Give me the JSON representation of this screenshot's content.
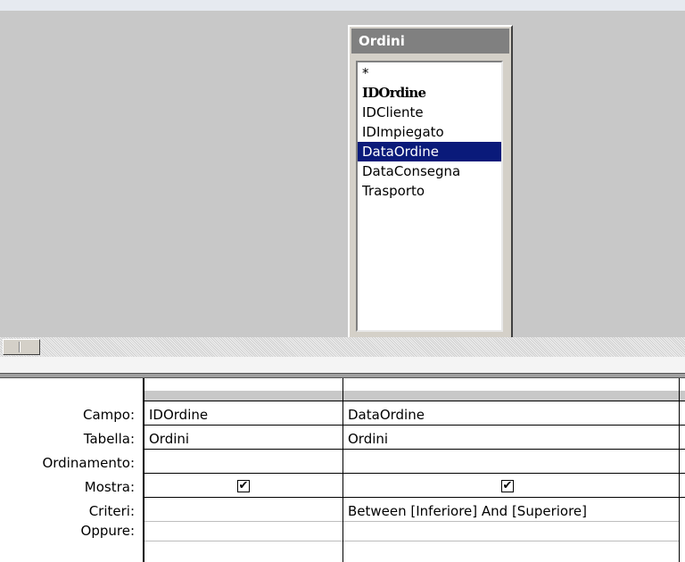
{
  "table": {
    "name": "Ordini",
    "fields": [
      "*",
      "IDOrdine",
      "IDCliente",
      "IDImpiegato",
      "DataOrdine",
      "DataConsegna",
      "Trasporto"
    ],
    "primary_key_field": "IDOrdine",
    "selected_field": "DataOrdine"
  },
  "grid": {
    "row_labels": {
      "campo": "Campo:",
      "tabella": "Tabella:",
      "ordinamento": "Ordinamento:",
      "mostra": "Mostra:",
      "criteri": "Criteri:",
      "oppure": "Oppure:"
    },
    "columns": [
      {
        "campo": "IDOrdine",
        "tabella": "Ordini",
        "ordinamento": "",
        "mostra": true,
        "criteri": "",
        "oppure": ""
      },
      {
        "campo": "DataOrdine",
        "tabella": "Ordini",
        "ordinamento": "",
        "mostra": true,
        "criteri": "Between [Inferiore] And [Superiore]",
        "oppure": ""
      }
    ]
  },
  "colors": {
    "selection": "#0a1a7a",
    "title_bar": "#808080",
    "pane_bg": "#c8c8c8"
  },
  "icons": {
    "checkmark": "check-icon"
  }
}
